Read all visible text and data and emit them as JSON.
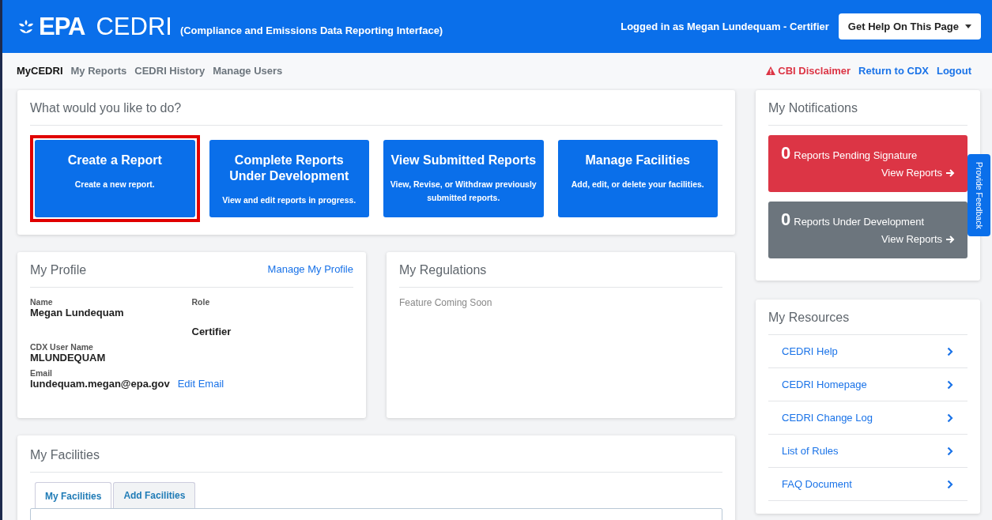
{
  "header": {
    "logo": "EPA",
    "app_name": "CEDRI",
    "app_subtitle": "(Compliance and Emissions Data Reporting Interface)",
    "user": "Logged in as Megan Lundequam - Certifier",
    "help_button": "Get Help On This Page"
  },
  "nav": {
    "items": [
      {
        "label": "MyCEDRI",
        "selected": true
      },
      {
        "label": "My Reports",
        "selected": false
      },
      {
        "label": "CEDRI History",
        "selected": false
      },
      {
        "label": "Manage Users",
        "selected": false
      }
    ],
    "links": [
      {
        "label": "CBI Disclaimer",
        "kind": "warning"
      },
      {
        "label": "Return to CDX",
        "kind": "plain"
      },
      {
        "label": "Logout",
        "kind": "plain"
      }
    ]
  },
  "actions": {
    "title": "What would you like to do?",
    "cards": [
      {
        "title": "Create a Report",
        "description": "Create a new report.",
        "highlighted": true
      },
      {
        "title": "Complete Reports Under Development",
        "description": "View and edit reports in progress.",
        "highlighted": false
      },
      {
        "title": "View Submitted Reports",
        "description": "View, Revise, or Withdraw previously submitted reports.",
        "highlighted": false
      },
      {
        "title": "Manage Facilities",
        "description": "Add, edit, or delete your facilities.",
        "highlighted": false
      }
    ]
  },
  "profile": {
    "title": "My Profile",
    "manage_link": "Manage My Profile",
    "fields": [
      {
        "label": "Name",
        "value": "Megan Lundequam"
      },
      {
        "label": "Role",
        "value": "Certifier"
      },
      {
        "label": "CDX User Name",
        "value": "MLUNDEQUAM"
      },
      {
        "label": "Email",
        "value": "lundequam.megan@epa.gov",
        "action": "Edit Email"
      }
    ]
  },
  "regulations": {
    "title": "My Regulations",
    "message": "Feature Coming Soon"
  },
  "facilities": {
    "title": "My Facilities",
    "tabs": [
      {
        "label": "My Facilities",
        "selected": true
      },
      {
        "label": "Add Facilities",
        "selected": false
      }
    ]
  },
  "notifications": {
    "title": "My Notifications",
    "items": [
      {
        "count": "0",
        "label": "Reports Pending Signature",
        "link": "View Reports",
        "color": "#dc3545"
      },
      {
        "count": "0",
        "label": "Reports Under Development",
        "link": "View Reports",
        "color": "#6c757d"
      }
    ]
  },
  "resources": {
    "title": "My Resources",
    "items": [
      "CEDRI Help",
      "CEDRI Homepage",
      "CEDRI Change Log",
      "List of Rules",
      "FAQ Document"
    ]
  },
  "feedback_tab": "Provide Feedback"
}
